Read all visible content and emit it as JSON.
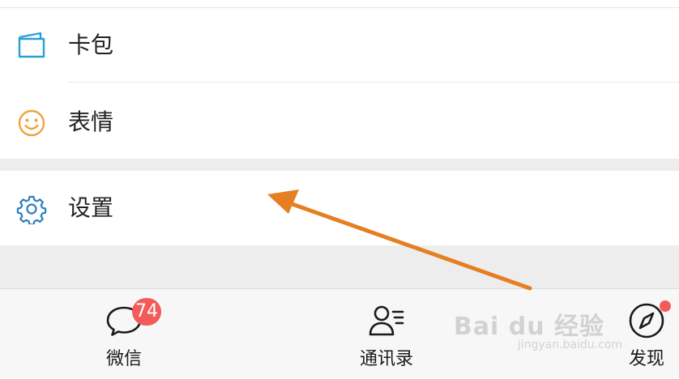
{
  "menu": {
    "items": [
      {
        "label": "卡包",
        "icon": "wallet-icon",
        "icon_color": "#2a9fd6"
      },
      {
        "label": "表情",
        "icon": "smiley-icon",
        "icon_color": "#f2a23c"
      },
      {
        "label": "设置",
        "icon": "gear-icon",
        "icon_color": "#2a7fc0"
      }
    ]
  },
  "tabbar": {
    "tabs": [
      {
        "label": "微信",
        "icon": "chat-bubble-icon",
        "badge": "74"
      },
      {
        "label": "通讯录",
        "icon": "contacts-icon"
      },
      {
        "label": "发现",
        "icon": "compass-icon"
      }
    ]
  },
  "watermark": {
    "main": "Bai du 经验",
    "sub": "jingyan.baidu.com"
  },
  "colors": {
    "badge": "#f35b5b",
    "annotation_arrow": "#e67e22",
    "section_gap": "#ededed"
  }
}
